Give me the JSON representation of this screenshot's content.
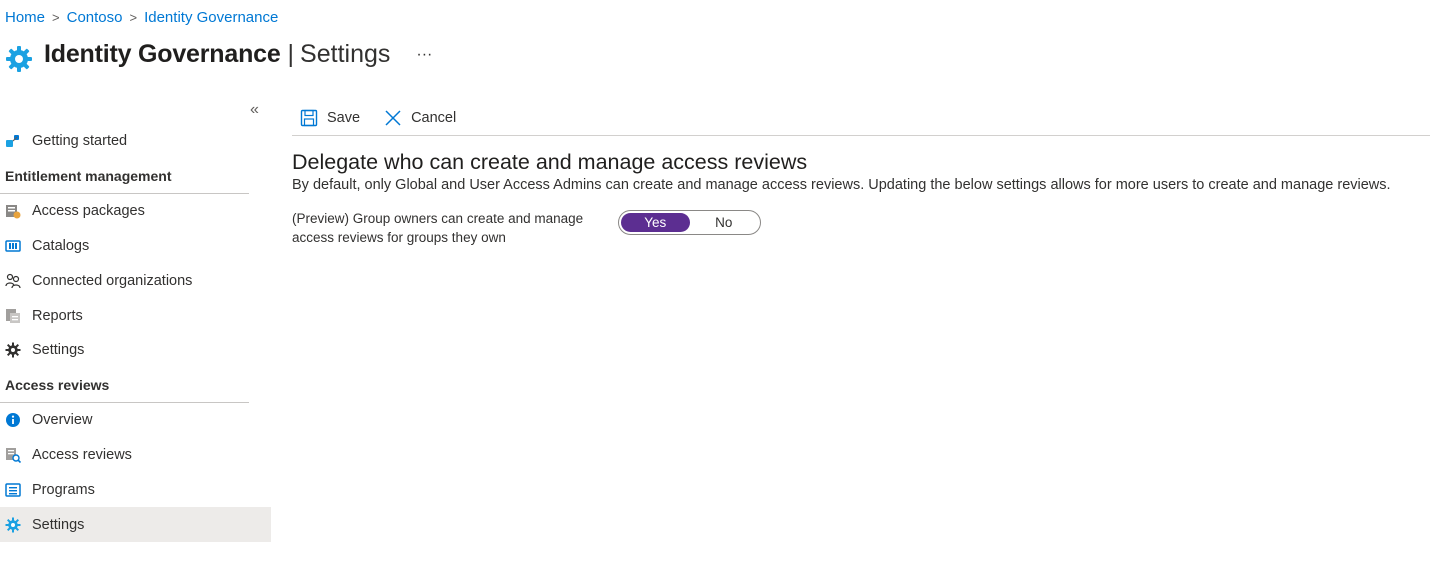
{
  "breadcrumb": [
    "Home",
    "Contoso",
    "Identity Governance"
  ],
  "header": {
    "title": "Identity Governance",
    "separator": "|",
    "subtitle": "Settings",
    "more": "···",
    "icon": "gear-icon"
  },
  "sidebar": {
    "collapse": "«",
    "getting_started": "Getting started",
    "section_entitlement": "Entitlement management",
    "entitlement_items": [
      "Access packages",
      "Catalogs",
      "Connected organizations",
      "Reports",
      "Settings"
    ],
    "section_reviews": "Access reviews",
    "review_items": [
      "Overview",
      "Access reviews",
      "Programs",
      "Settings"
    ]
  },
  "toolbar": {
    "save_label": "Save",
    "cancel_label": "Cancel"
  },
  "content": {
    "heading": "Delegate who can create and manage access reviews",
    "description": "By default, only Global and User Access Admins can create and manage access reviews. Updating the below settings allows for more users to create and manage reviews.",
    "setting_label_line1": "(Preview) Group owners can create and manage",
    "setting_label_line2": "access reviews for groups they own",
    "toggle_yes": "Yes",
    "toggle_no": "No",
    "toggle_selected": "Yes"
  },
  "colors": {
    "link": "#0078d4",
    "toggle_on": "#5c2e91",
    "selected_bg": "#edebe9",
    "icon_blue": "#0078d4"
  }
}
